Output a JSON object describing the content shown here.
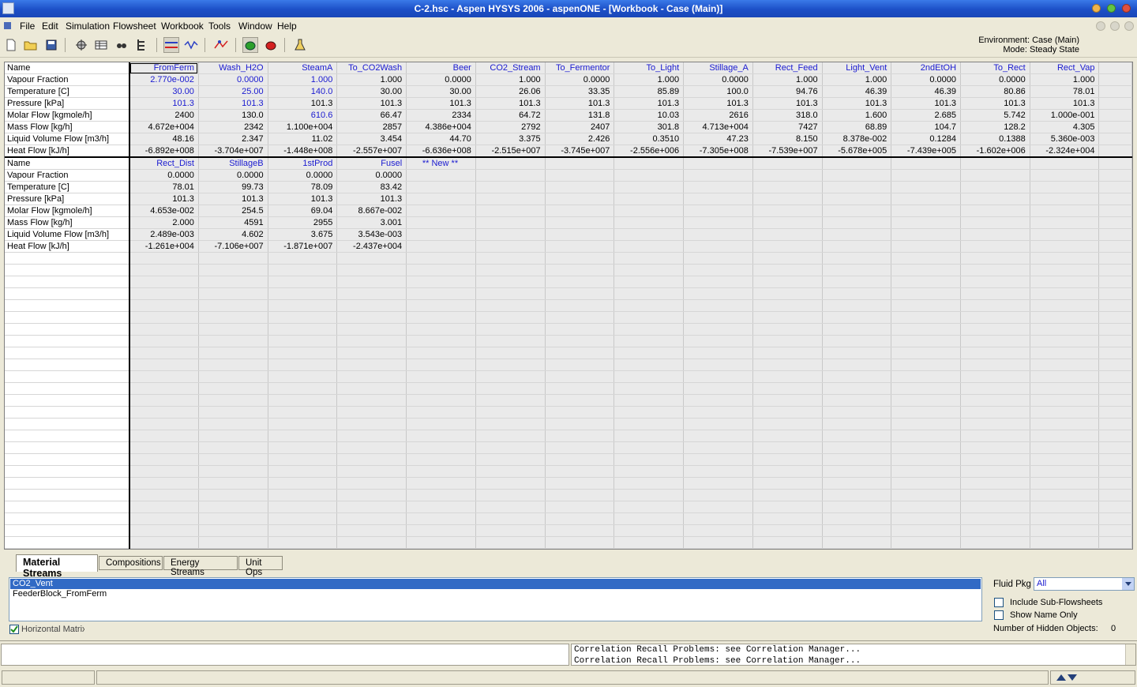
{
  "window": {
    "title": "C-2.hsc - Aspen HYSYS 2006 - aspenONE - [Workbook - Case (Main)]"
  },
  "menu": [
    "File",
    "Edit",
    "Simulation",
    "Flowsheet",
    "Workbook",
    "Tools",
    "Window",
    "Help"
  ],
  "toolbar_icons": [
    "new-file-icon",
    "open-folder-icon",
    "save-icon",
    "object-navigator-icon",
    "workbook-icon",
    "binoculars-icon",
    "tree-icon",
    "material-stream-icon",
    "energy-stream-icon",
    "pfd-icon",
    "solver-active-icon",
    "solver-hold-icon",
    "flask-icon"
  ],
  "environment": {
    "env_text": "Environment: Case (Main)",
    "mode_text": "Mode: Steady State"
  },
  "colors": {
    "link_blue": "#1a1ad0",
    "selection": "#316ac5",
    "title_bar": "#1c4fc7"
  },
  "row_labels": [
    "Name",
    "Vapour Fraction",
    "Temperature [C]",
    "Pressure [kPa]",
    "Molar Flow [kgmole/h]",
    "Mass Flow [kg/h]",
    "Liquid Volume Flow [m3/h]",
    "Heat Flow [kJ/h]"
  ],
  "table1": {
    "streams": [
      {
        "name": "FromFerm",
        "values": [
          "2.770e-002",
          "30.00",
          "101.3",
          "2400",
          "4.672e+004",
          "48.16",
          "-6.892e+008"
        ]
      },
      {
        "name": "Wash_H2O",
        "values": [
          "0.0000",
          "25.00",
          "101.3",
          "130.0",
          "2342",
          "2.347",
          "-3.704e+007"
        ]
      },
      {
        "name": "SteamA",
        "values": [
          "1.000",
          "140.0",
          "101.3",
          "610.6",
          "1.100e+004",
          "11.02",
          "-1.448e+008"
        ]
      },
      {
        "name": "To_CO2Wash",
        "values": [
          "1.000",
          "30.00",
          "101.3",
          "66.47",
          "2857",
          "3.454",
          "-2.557e+007"
        ]
      },
      {
        "name": "Beer",
        "values": [
          "0.0000",
          "30.00",
          "101.3",
          "2334",
          "4.386e+004",
          "44.70",
          "-6.636e+008"
        ]
      },
      {
        "name": "CO2_Stream",
        "values": [
          "1.000",
          "26.06",
          "101.3",
          "64.72",
          "2792",
          "3.375",
          "-2.515e+007"
        ]
      },
      {
        "name": "To_Fermentor",
        "values": [
          "0.0000",
          "33.35",
          "101.3",
          "131.8",
          "2407",
          "2.426",
          "-3.745e+007"
        ]
      },
      {
        "name": "To_Light",
        "values": [
          "1.000",
          "85.89",
          "101.3",
          "10.03",
          "301.8",
          "0.3510",
          "-2.556e+006"
        ]
      },
      {
        "name": "Stillage_A",
        "values": [
          "0.0000",
          "100.0",
          "101.3",
          "2616",
          "4.713e+004",
          "47.23",
          "-7.305e+008"
        ]
      },
      {
        "name": "Rect_Feed",
        "values": [
          "1.000",
          "94.76",
          "101.3",
          "318.0",
          "7427",
          "8.150",
          "-7.539e+007"
        ]
      },
      {
        "name": "Light_Vent",
        "values": [
          "1.000",
          "46.39",
          "101.3",
          "1.600",
          "68.89",
          "8.378e-002",
          "-5.678e+005"
        ]
      },
      {
        "name": "2ndEtOH",
        "values": [
          "0.0000",
          "46.39",
          "101.3",
          "2.685",
          "104.7",
          "0.1284",
          "-7.439e+005"
        ]
      },
      {
        "name": "To_Rect",
        "values": [
          "0.0000",
          "80.86",
          "101.3",
          "5.742",
          "128.2",
          "0.1388",
          "-1.602e+006"
        ]
      },
      {
        "name": "Rect_Vap",
        "values": [
          "1.000",
          "78.01",
          "101.3",
          "1.000e-001",
          "4.305",
          "5.360e-003",
          "-2.324e+004"
        ]
      }
    ]
  },
  "table2": {
    "streams": [
      {
        "name": "Rect_Dist",
        "values": [
          "0.0000",
          "78.01",
          "101.3",
          "4.653e-002",
          "2.000",
          "2.489e-003",
          "-1.261e+004"
        ]
      },
      {
        "name": "StillageB",
        "values": [
          "0.0000",
          "99.73",
          "101.3",
          "254.5",
          "4591",
          "4.602",
          "-7.106e+007"
        ]
      },
      {
        "name": "1stProd",
        "values": [
          "0.0000",
          "78.09",
          "101.3",
          "69.04",
          "2955",
          "3.675",
          "-1.871e+007"
        ]
      },
      {
        "name": "Fusel",
        "values": [
          "0.0000",
          "83.42",
          "101.3",
          "8.667e-002",
          "3.001",
          "3.543e-003",
          "-2.437e+004"
        ]
      }
    ],
    "new_label": "** New **"
  },
  "tabs": [
    "Material Streams",
    "Compositions",
    "Energy Streams",
    "Unit Ops"
  ],
  "list_items": [
    "CO2_Vent",
    "FeederBlock_FromFerm"
  ],
  "horizontal_matrix_label": "Horizontal Matrix",
  "fluid_pkg": {
    "label": "Fluid Pkg",
    "value": "All"
  },
  "options": {
    "include_sub": "Include Sub-Flowsheets",
    "show_name_only": "Show Name Only",
    "hidden_label": "Number of Hidden Objects:",
    "hidden_count": "0"
  },
  "messages": [
    "Correlation Recall Problems: see Correlation Manager...",
    "Correlation Recall Problems: see Correlation Manager..."
  ]
}
